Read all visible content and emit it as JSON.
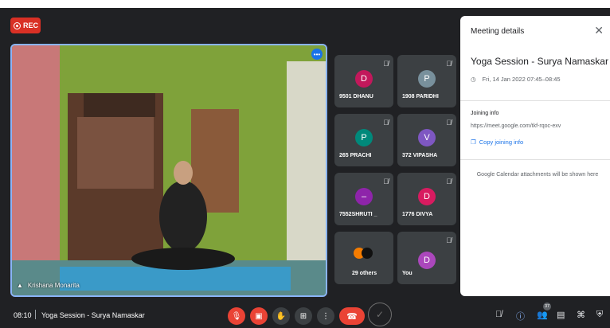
{
  "recording": {
    "label": "REC"
  },
  "main_video": {
    "participant_name": "Krishana Monarita"
  },
  "tiles": [
    {
      "name": "9501 DHANU",
      "initial": "D",
      "color": "#c2185b"
    },
    {
      "name": "1908 PARIDHI",
      "initial": "P",
      "color": "#78909c"
    },
    {
      "name": "265 PRACHI",
      "initial": "P",
      "color": "#00897b"
    },
    {
      "name": "372 VIPASHA",
      "initial": "V",
      "color": "#7e57c2"
    },
    {
      "name": "7552SHRUTI _",
      "initial": "–",
      "color": "#8e24aa"
    },
    {
      "name": "1776 DIVYA",
      "initial": "D",
      "color": "#d81b60"
    },
    {
      "name": "29 others",
      "initial": "",
      "color": "#3c4043"
    },
    {
      "name": "You",
      "initial": "D",
      "color": "#ab47bc"
    }
  ],
  "meeting_details": {
    "header": "Meeting details",
    "title": "Yoga Session - Surya Namaskar",
    "datetime": "Fri, 14 Jan 2022 07:45–08:45",
    "joining_header": "Joining info",
    "joining_url": "https://meet.google.com/tkf-rqoc-exv",
    "copy_label": "Copy joining info",
    "attachments_note": "Google Calendar attachments will be shown here"
  },
  "bottom_bar": {
    "time": "08:10",
    "meeting_title": "Yoga Session - Surya Namaskar",
    "participants_count": "37"
  },
  "icons": {
    "mic_off": "mic-off-icon",
    "camera_off": "camera-off-icon",
    "raise_hand": "raise-hand-icon",
    "present": "present-icon",
    "more": "more-options-icon",
    "end_call": "end-call-icon"
  }
}
